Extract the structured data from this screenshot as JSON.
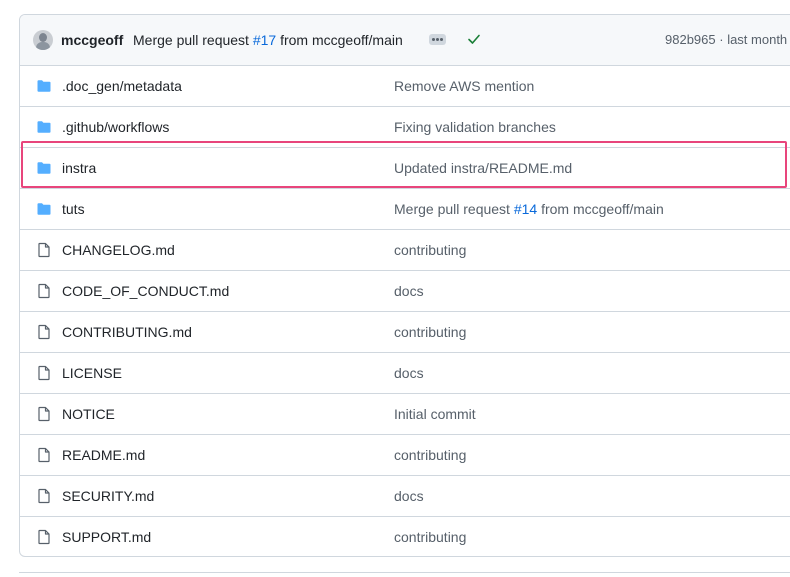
{
  "commit": {
    "author": "mccgeoff",
    "message_prefix": "Merge pull request ",
    "pr_link": "#17",
    "message_suffix": " from mccgeoff/main",
    "sha": "982b965",
    "separator": " · ",
    "time": "last month",
    "status_icon": "check-icon",
    "more_icon": "ellipsis-icon"
  },
  "files": [
    {
      "type": "folder",
      "name": ".doc_gen/metadata",
      "commit": "Remove AWS mention"
    },
    {
      "type": "folder",
      "name": ".github/workflows",
      "commit": "Fixing validation branches"
    },
    {
      "type": "folder",
      "name": "instra",
      "commit": "Updated instra/README.md",
      "highlighted": true
    },
    {
      "type": "folder",
      "name": "tuts",
      "commit_prefix": "Merge pull request ",
      "commit_link": "#14",
      "commit_suffix": " from mccgeoff/main"
    },
    {
      "type": "file",
      "name": "CHANGELOG.md",
      "commit": "contributing"
    },
    {
      "type": "file",
      "name": "CODE_OF_CONDUCT.md",
      "commit": "docs"
    },
    {
      "type": "file",
      "name": "CONTRIBUTING.md",
      "commit": "contributing"
    },
    {
      "type": "file",
      "name": "LICENSE",
      "commit": "docs"
    },
    {
      "type": "file",
      "name": "NOTICE",
      "commit": "Initial commit"
    },
    {
      "type": "file",
      "name": "README.md",
      "commit": "contributing"
    },
    {
      "type": "file",
      "name": "SECURITY.md",
      "commit": "docs"
    },
    {
      "type": "file",
      "name": "SUPPORT.md",
      "commit": "contributing"
    }
  ],
  "colors": {
    "folder": "#54aeff",
    "link": "#0969da",
    "highlight": "#e8457c",
    "success": "#1a7f37"
  }
}
